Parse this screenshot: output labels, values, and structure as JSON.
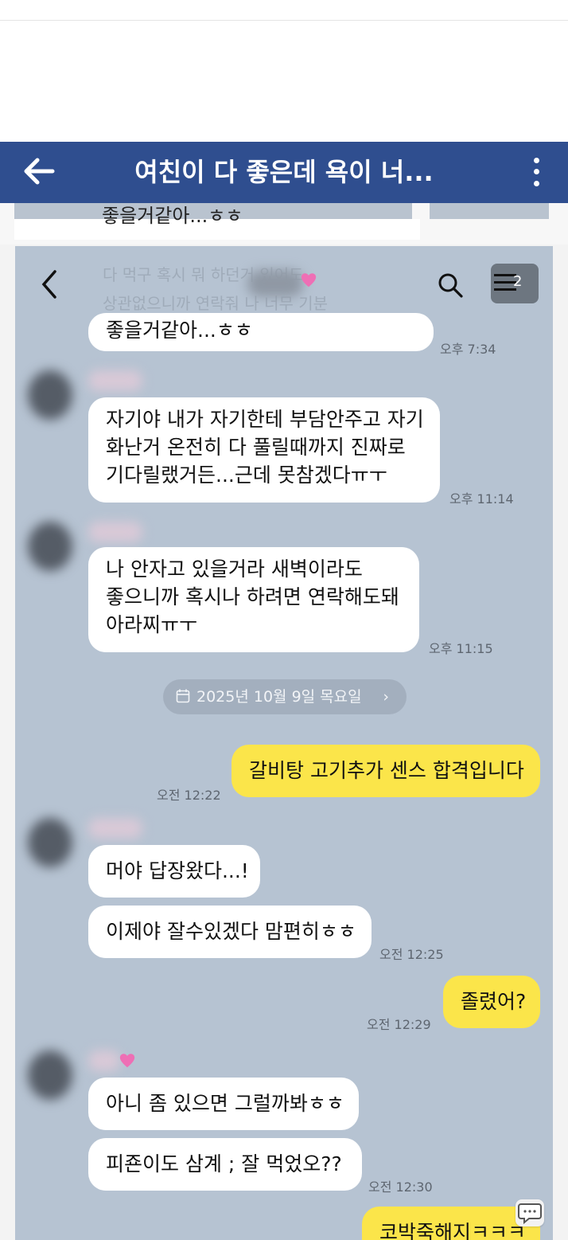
{
  "header": {
    "title": "여친이 다 좋은데 욕이 너..."
  },
  "strip_text": "좋을거같아...ㅎㅎ",
  "chat": {
    "menu_count": "2",
    "ghost_lines": [
      "다 먹구 혹시 뭐 하던거 있어도",
      "상관없으니까 연락줘 나 너무 기분"
    ],
    "date_divider": "2025년 10월 9일 목요일",
    "messages": [
      {
        "text": "좋을거같아...ㅎㅎ",
        "time": "오후 7:34"
      },
      {
        "text": "자기야 내가 자기한테 부담안주고 자기\n화난거 온전히 다 풀릴때까지 진짜로\n기다릴랬거든...근데 못참겠다ㅠㅜ",
        "time": "오후 11:14"
      },
      {
        "text": "나 안자고 있을거라 새벽이라도\n좋으니까 혹시나 하려면 연락해도돼\n아라찌ㅠㅜ",
        "time": "오후 11:15"
      },
      {
        "text": "갈비탕 고기추가 센스 합격입니다",
        "time": "오전 12:22"
      },
      {
        "text": "머야 답장왔다...!"
      },
      {
        "text": "이제야 잘수있겠다 맘편히ㅎㅎ",
        "time": "오전 12:25"
      },
      {
        "text": "졸렸어?",
        "time": "오전 12:29"
      },
      {
        "text": "아니 좀 있으면 그럴까봐ㅎㅎ"
      },
      {
        "text": "피죤이도 삼계 ; 잘 먹었오??",
        "time": "오전 12:30"
      },
      {
        "text": "코박죽해지ㅋㅋㅋ"
      }
    ]
  },
  "colors": {
    "header_bg": "#2f4e8f",
    "chat_bg": "#b6c3d2",
    "my_bubble": "#fbe54a",
    "their_bubble": "#ffffff"
  }
}
